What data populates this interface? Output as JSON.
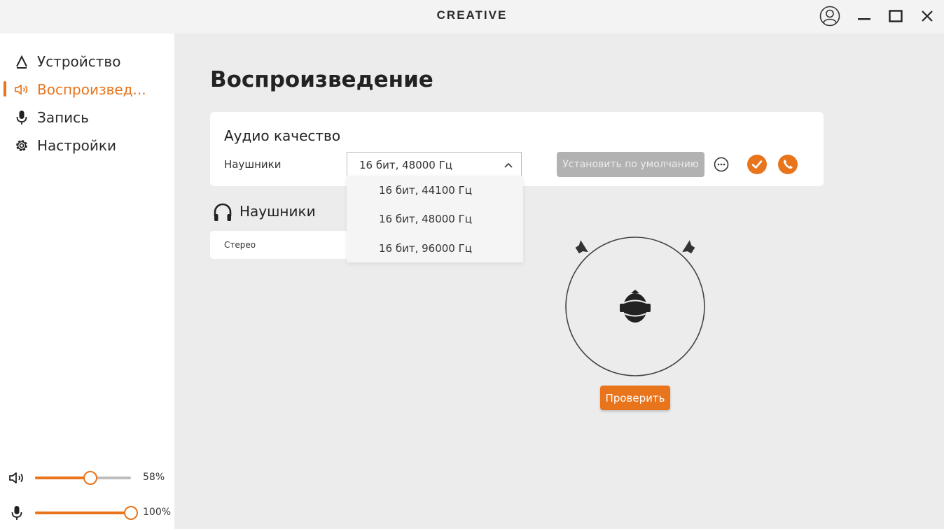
{
  "app": {
    "brand": "CREATIVE"
  },
  "window": {
    "controls": [
      "user-icon",
      "minimize-icon",
      "maximize-icon",
      "close-icon"
    ]
  },
  "sidebar": {
    "items": [
      {
        "label": "Устройство",
        "icon": "device-icon",
        "active": false
      },
      {
        "label": "Воспроизвед...",
        "icon": "speaker-icon",
        "active": true
      },
      {
        "label": "Запись",
        "icon": "microphone-icon",
        "active": false
      },
      {
        "label": "Настройки",
        "icon": "gear-icon",
        "active": false
      }
    ],
    "playback_volume": {
      "value": 0.58,
      "display": "58%"
    },
    "mic_volume": {
      "value": 1.0,
      "display": "100%"
    }
  },
  "main": {
    "title": "Воспроизведение",
    "audio_quality": {
      "title": "Аудио качество",
      "device_label": "Наушники",
      "selected": "16 бит, 48000 Гц",
      "options": [
        "16 бит, 44100 Гц",
        "16 бит, 48000 Гц",
        "16 бит, 96000 Гц"
      ],
      "default_button": "Установить по умолчанию"
    },
    "headphones": {
      "title": "Наушники",
      "mode": "Стерео"
    },
    "test_button": "Проверить"
  },
  "colors": {
    "accent": "#e8741c",
    "sidebar_bg": "#ffffff",
    "main_bg": "#ececec",
    "disabled_button": "#b2b2b2"
  }
}
